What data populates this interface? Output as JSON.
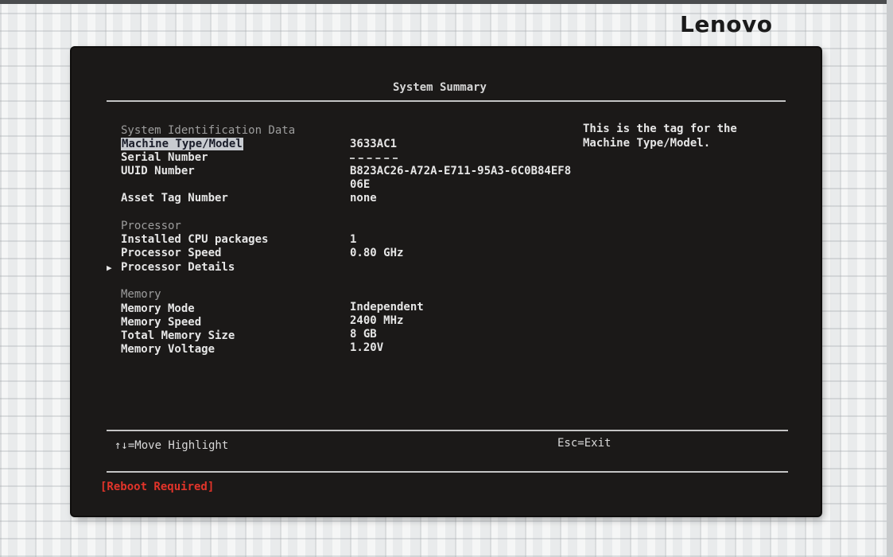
{
  "brand": {
    "logo_text": "Lenovo"
  },
  "screen": {
    "title": "System Summary",
    "sections": {
      "identification": {
        "heading": "System Identification Data",
        "machine_type_label": "Machine Type/Model",
        "machine_type_value": "3633AC1",
        "serial_label": "Serial Number",
        "serial_value": "",
        "uuid_label": "UUID Number",
        "uuid_value_line1": "B823AC26-A72A-E711-95A3-6C0B84EF8",
        "uuid_value_line2": "06E",
        "asset_label": "Asset Tag Number",
        "asset_value": "none"
      },
      "processor": {
        "heading": "Processor",
        "cpu_packages_label": "Installed CPU packages",
        "cpu_packages_value": "1",
        "speed_label": "Processor Speed",
        "speed_value": "0.80 GHz",
        "details_label": "Processor Details"
      },
      "memory": {
        "heading": "Memory",
        "mode_label": "Memory Mode",
        "mode_value": "Independent",
        "speed_label": "Memory Speed",
        "speed_value": "2400 MHz",
        "size_label": "Total Memory Size",
        "size_value": "8 GB",
        "voltage_label": "Memory Voltage",
        "voltage_value": "1.20V"
      }
    },
    "help_text": "This is the tag for the\nMachine Type/Model.",
    "footer": {
      "move_hint": "↑↓=Move Highlight",
      "exit_hint": "Esc=Exit"
    },
    "status": "[Reboot Required]",
    "colors": {
      "screen_bg": "#1b1918",
      "text": "#e6e6e6",
      "section_heading": "#9d9d9d",
      "highlight_bg": "#c8cbd0",
      "warning": "#e2342a"
    }
  }
}
